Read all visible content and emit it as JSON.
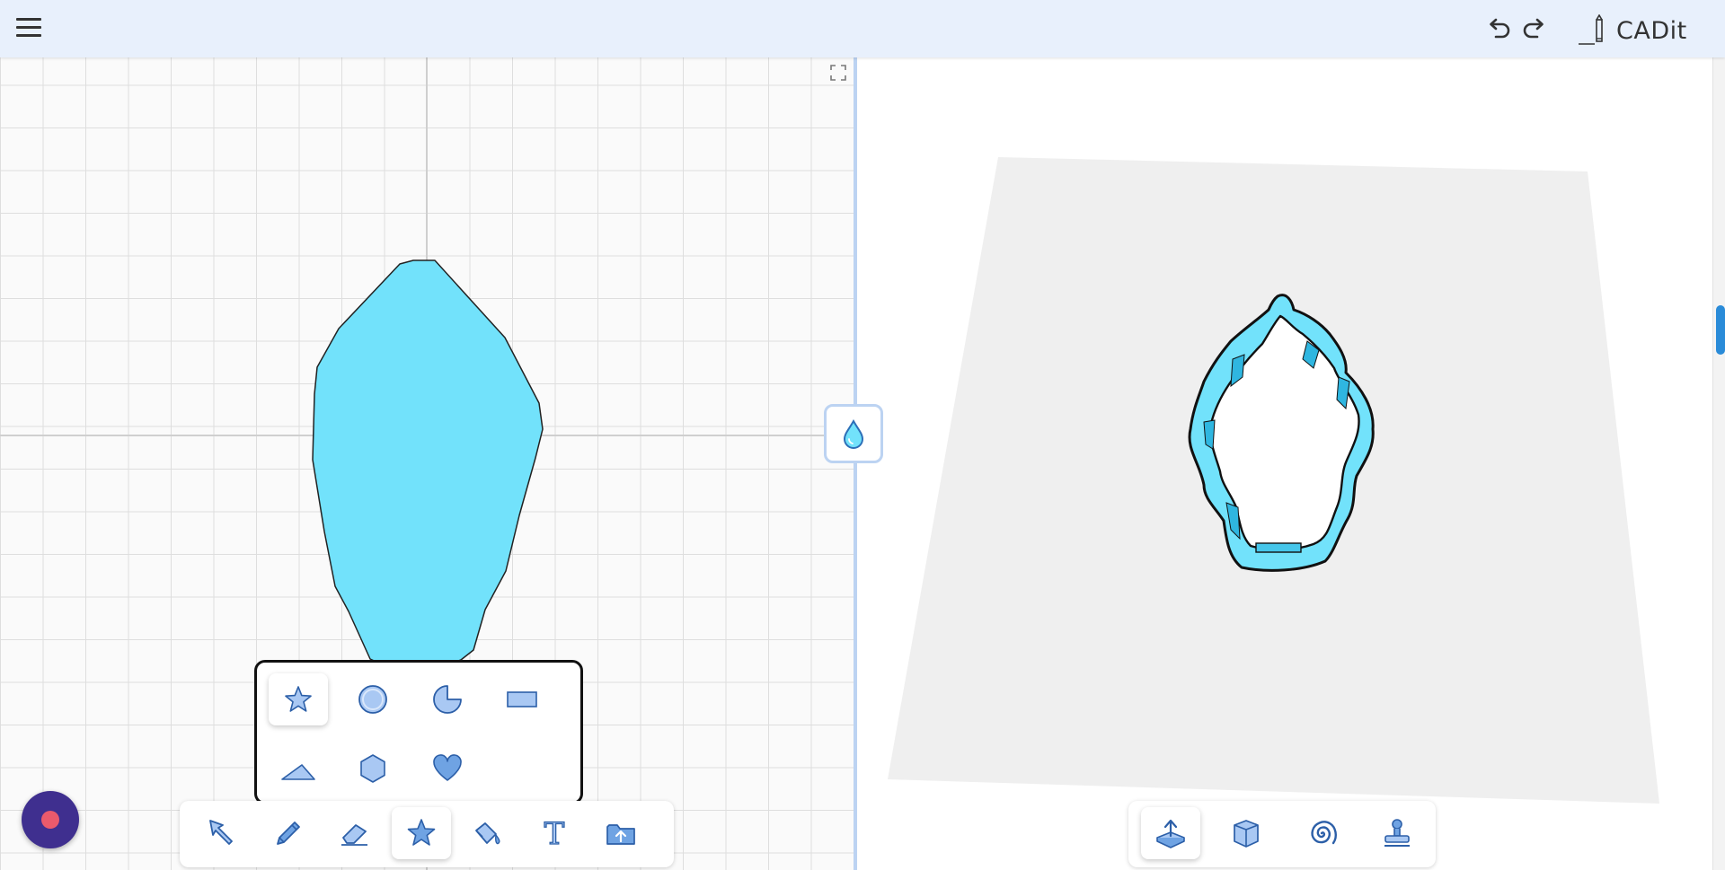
{
  "app": {
    "name": "CADit",
    "menu_icon": "hamburger-icon",
    "undo_icon": "undo-icon",
    "redo_icon": "redo-icon",
    "logo_icon": "pencil-logo-icon"
  },
  "colors": {
    "topbar": "#e8f0fc",
    "accent_blue": "#6fa3e3",
    "shape_fill": "#72e2fb",
    "floor": "#efefef",
    "record_button": "#3f2f8f",
    "record_dot": "#ea5a6c",
    "divider": "#bcd3f2",
    "scroll_thumb": "#2a8bd8"
  },
  "sketch": {
    "expand_icons": [
      "expand-corners-icon",
      "expand-corners-icon"
    ],
    "center_button_icon": "water-drop-icon"
  },
  "shape_palette": {
    "items": [
      {
        "icon": "star-icon",
        "selected": true
      },
      {
        "icon": "circle-icon",
        "selected": false
      },
      {
        "icon": "pie-icon",
        "selected": false
      },
      {
        "icon": "rectangle-icon",
        "selected": false
      },
      {
        "icon": "triangle-icon",
        "selected": false
      },
      {
        "icon": "hexagon-icon",
        "selected": false
      },
      {
        "icon": "heart-icon",
        "selected": false
      }
    ]
  },
  "sketch_toolbar": {
    "tools": [
      {
        "icon": "select-arrow-icon",
        "active": false
      },
      {
        "icon": "pencil-icon",
        "active": false
      },
      {
        "icon": "eraser-icon",
        "active": false
      },
      {
        "icon": "star-shapes-icon",
        "active": true
      },
      {
        "icon": "paint-bucket-icon",
        "active": false
      },
      {
        "icon": "text-tool-icon",
        "label": "T",
        "active": false
      },
      {
        "icon": "upload-folder-icon",
        "active": false
      }
    ]
  },
  "view3d_toolbar": {
    "tools": [
      {
        "icon": "extrude-icon",
        "active": true
      },
      {
        "icon": "box-icon",
        "active": false
      },
      {
        "icon": "spiral-icon",
        "active": false
      },
      {
        "icon": "stamp-icon",
        "active": false
      }
    ]
  },
  "record_button": {
    "icon": "record-icon"
  }
}
